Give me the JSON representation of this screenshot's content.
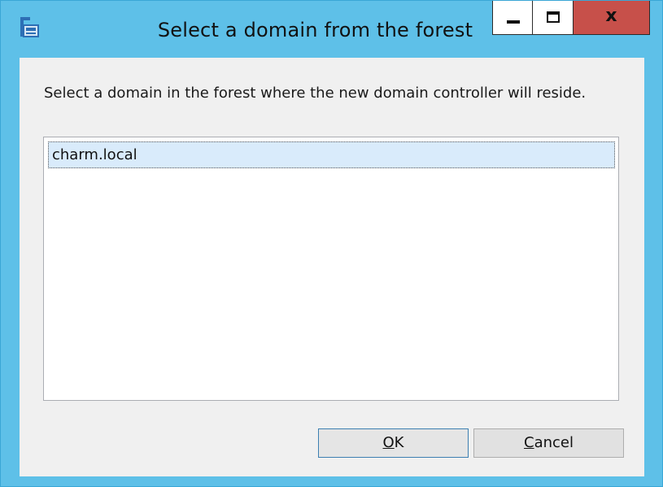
{
  "window": {
    "title": "Select a domain from the forest",
    "icon": "domain-icon",
    "controls": {
      "minimize_icon": "minimize-icon",
      "maximize_icon": "maximize-icon",
      "close_glyph": "x"
    },
    "colors": {
      "frame": "#5ec0e8",
      "close": "#c7504a",
      "selection": "#d9ebfb"
    }
  },
  "dialog": {
    "prompt": "Select a domain in the forest where the new domain controller will reside.",
    "list": {
      "items": [
        "charm.local"
      ],
      "selected_index": 0
    },
    "buttons": {
      "ok": {
        "accel": "O",
        "rest": "K"
      },
      "cancel": {
        "accel": "C",
        "rest": "ancel"
      }
    }
  }
}
